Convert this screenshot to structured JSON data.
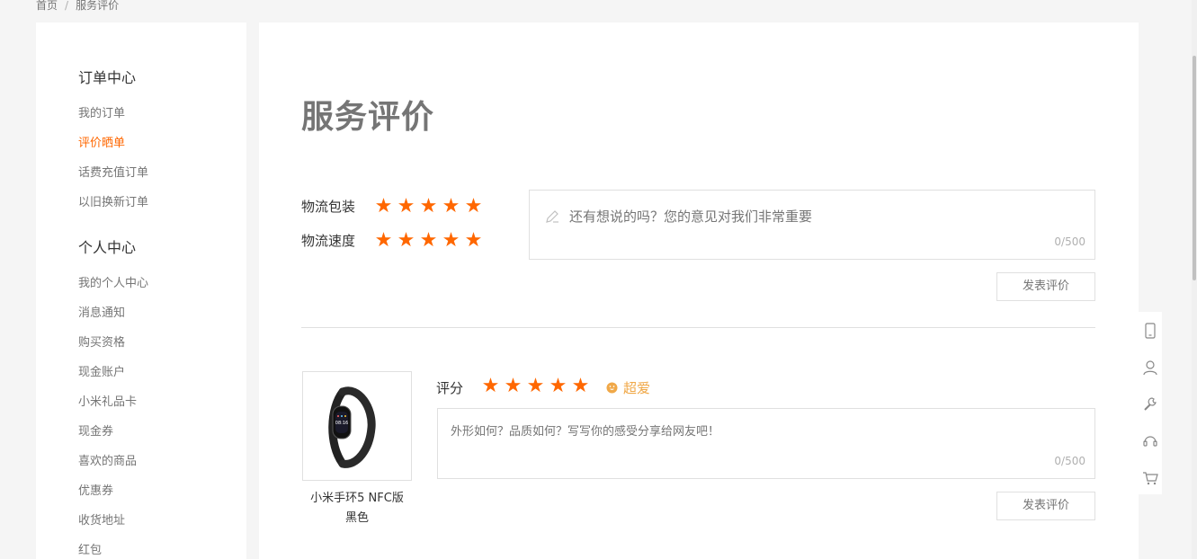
{
  "breadcrumb": {
    "home": "首页",
    "separator": "/",
    "current": "服务评价"
  },
  "sidebar": {
    "groups": [
      {
        "title": "订单中心",
        "items": [
          "我的订单",
          "评价晒单",
          "话费充值订单",
          "以旧换新订单"
        ]
      },
      {
        "title": "个人中心",
        "items": [
          "我的个人中心",
          "消息通知",
          "购买资格",
          "现金账户",
          "小米礼品卡",
          "现金券",
          "喜欢的商品",
          "优惠券",
          "收货地址",
          "红包"
        ]
      }
    ],
    "active_item": "评价晒单"
  },
  "main": {
    "title": "服务评价",
    "service": {
      "logistics_packaging_label": "物流包装",
      "logistics_packaging_rating": 5,
      "logistics_speed_label": "物流速度",
      "logistics_speed_rating": 5,
      "comment_placeholder": "还有想说的吗？您的意见对我们非常重要",
      "counter": "0/500",
      "submit_label": "发表评价"
    },
    "product": {
      "name_line1": "小米手环5 NFC版",
      "name_line2": "黑色",
      "score_label": "评分",
      "rating": 5,
      "rating_text": "超爱",
      "comment_placeholder": "外形如何？品质如何？写写你的感受分享给网友吧！",
      "counter": "0/500",
      "submit_label": "发表评价"
    }
  },
  "right_bar": {
    "icons": [
      "phone-icon",
      "user-icon",
      "wrench-icon",
      "headset-icon",
      "cart-icon"
    ]
  },
  "colors": {
    "accent": "#ff6700",
    "love": "#f0a848",
    "muted": "#757575",
    "border": "#e0e0e0"
  }
}
